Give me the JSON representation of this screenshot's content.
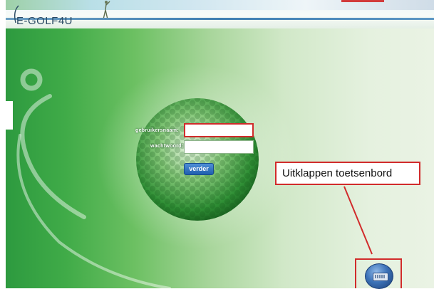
{
  "header": {
    "logo_text": "E-GOLF4U",
    "logo_icon": "golf-swoosh-logo-icon"
  },
  "login": {
    "username_label": "gebruikersnaam:",
    "username_value": "",
    "password_label": "wachtwoord:",
    "password_value": "",
    "submit_label": "verder"
  },
  "annotation": {
    "callout_text": "Uitklappen toetsenbord",
    "highlight_color": "#d12b2b"
  },
  "keyboard_button": {
    "icon": "keyboard-icon"
  },
  "colors": {
    "background_green": "#40ab48",
    "button_blue": "#1f5fae"
  }
}
